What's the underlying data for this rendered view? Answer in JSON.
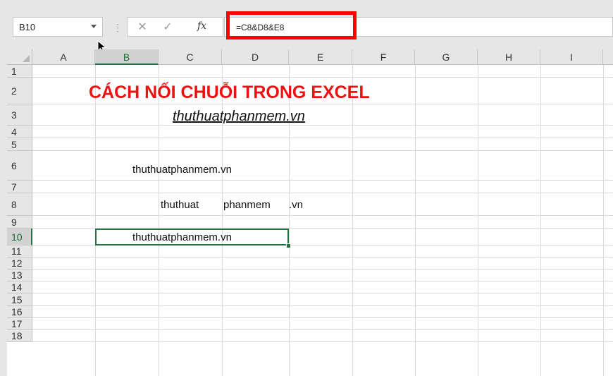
{
  "formula_bar": {
    "name_box": "B10",
    "cancel_icon": "✕",
    "enter_icon": "✓",
    "fx_label": "fx",
    "formula": "=C8&D8&E8"
  },
  "columns": [
    "A",
    "B",
    "C",
    "D",
    "E",
    "F",
    "G",
    "H",
    "I"
  ],
  "selected_column": "B",
  "rows": [
    "1",
    "2",
    "3",
    "4",
    "5",
    "6",
    "7",
    "8",
    "9",
    "10",
    "11",
    "12",
    "13",
    "14",
    "15",
    "16",
    "17",
    "18"
  ],
  "selected_row": "10",
  "cells": {
    "title": "CÁCH NỐI CHUỖI TRONG EXCEL",
    "subtitle": "thuthuatphanmem.vn",
    "b6": "thuthuatphanmem.vn",
    "c8": "thuthuat",
    "d8": "phanmem",
    "e8": ".vn",
    "b10": "thuthuatphanmem.vn"
  },
  "colors": {
    "title": "#ee1111",
    "highlight": "#ff0000",
    "excel_green": "#217346"
  }
}
